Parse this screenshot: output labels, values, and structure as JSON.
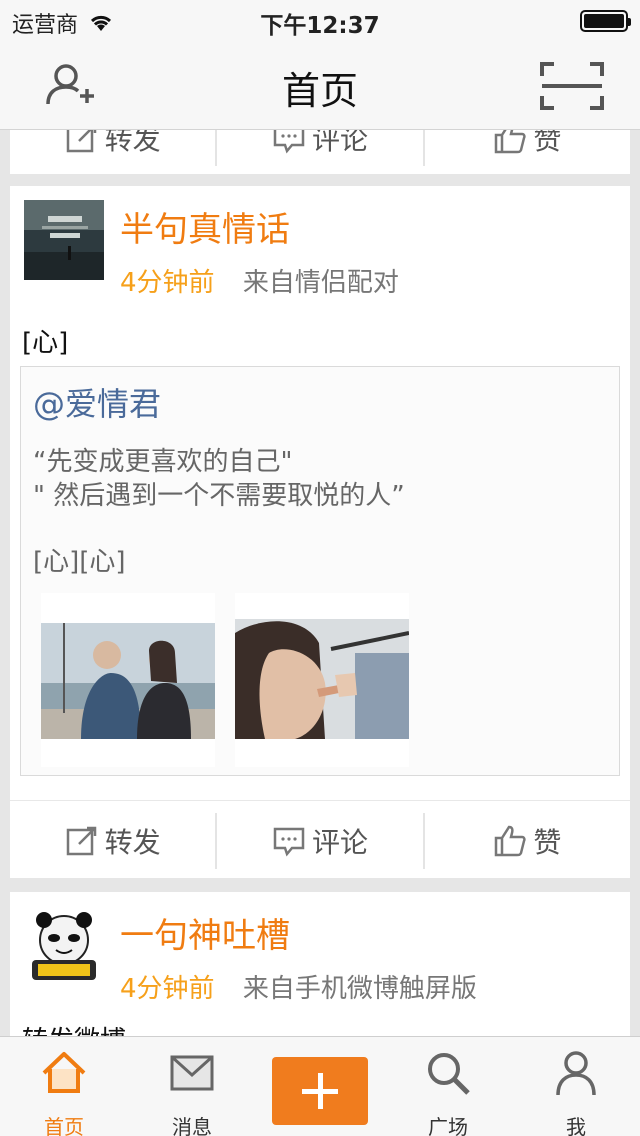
{
  "status_bar": {
    "carrier": "运营商",
    "time": "下午12:37"
  },
  "nav": {
    "title": "首页",
    "left_icon": "add-friend-icon",
    "right_icon": "scan-icon"
  },
  "actions": {
    "repost": "转发",
    "comment": "评论",
    "like": "赞"
  },
  "posts": [
    {
      "user": "半句真情话",
      "time": "4分钟前",
      "source": "来自情侣配对",
      "text": "[心]",
      "quote": {
        "user": "@爱情君",
        "line1": "“先变成更喜欢的自己\"",
        "line2": "\" 然后遇到一个不需要取悦的人”",
        "line3": "[心][心]"
      }
    },
    {
      "user": "一句神吐槽",
      "time": "4分钟前",
      "source": "来自手机微博触屏版",
      "text": "转发微博"
    }
  ],
  "tabs": [
    {
      "label": "首页",
      "icon": "home-icon",
      "active": true
    },
    {
      "label": "消息",
      "icon": "message-icon",
      "active": false
    },
    {
      "label": "",
      "icon": "compose-icon",
      "active": false
    },
    {
      "label": "广场",
      "icon": "search-icon",
      "active": false
    },
    {
      "label": "我",
      "icon": "profile-icon",
      "active": false
    }
  ],
  "colors": {
    "accent": "#f07c11",
    "time": "#f6a01a",
    "link": "#4a6a9a"
  }
}
